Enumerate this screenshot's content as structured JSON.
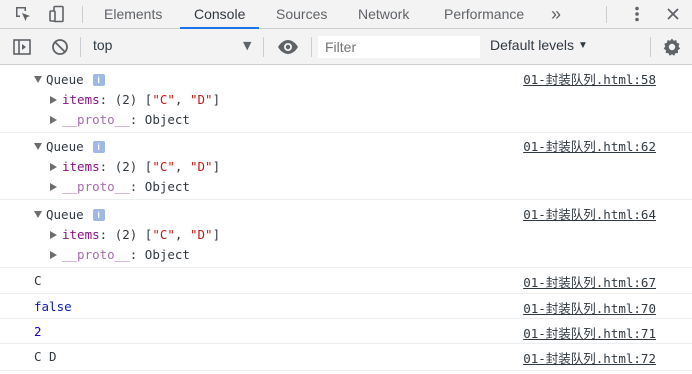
{
  "tabs": {
    "elements": "Elements",
    "console": "Console",
    "sources": "Sources",
    "network": "Network",
    "performance": "Performance",
    "more": "»"
  },
  "toolbar": {
    "context": "top",
    "filter_placeholder": "Filter",
    "levels": "Default levels"
  },
  "queue_groups": [
    {
      "title": "Queue",
      "items_key": "items",
      "items_len": "(2)",
      "item_a": "\"C\"",
      "item_b": "\"D\"",
      "proto_key": "__proto__",
      "proto_val": "Object",
      "source": "01-封装队列.html:58"
    },
    {
      "title": "Queue",
      "items_key": "items",
      "items_len": "(2)",
      "item_a": "\"C\"",
      "item_b": "\"D\"",
      "proto_key": "__proto__",
      "proto_val": "Object",
      "source": "01-封装队列.html:62"
    },
    {
      "title": "Queue",
      "items_key": "items",
      "items_len": "(2)",
      "item_a": "\"C\"",
      "item_b": "\"D\"",
      "proto_key": "__proto__",
      "proto_val": "Object",
      "source": "01-封装队列.html:64"
    }
  ],
  "logs": [
    {
      "text": "C",
      "source": "01-封装队列.html:67"
    },
    {
      "text": "false",
      "source": "01-封装队列.html:70"
    },
    {
      "text": "2",
      "source": "01-封装队列.html:71"
    },
    {
      "text": "C D",
      "source": "01-封装队列.html:72"
    }
  ],
  "colors": {
    "accent": "#1a73e8",
    "string": "#c41a16",
    "key": "#881280",
    "number": "#1c00cf"
  }
}
